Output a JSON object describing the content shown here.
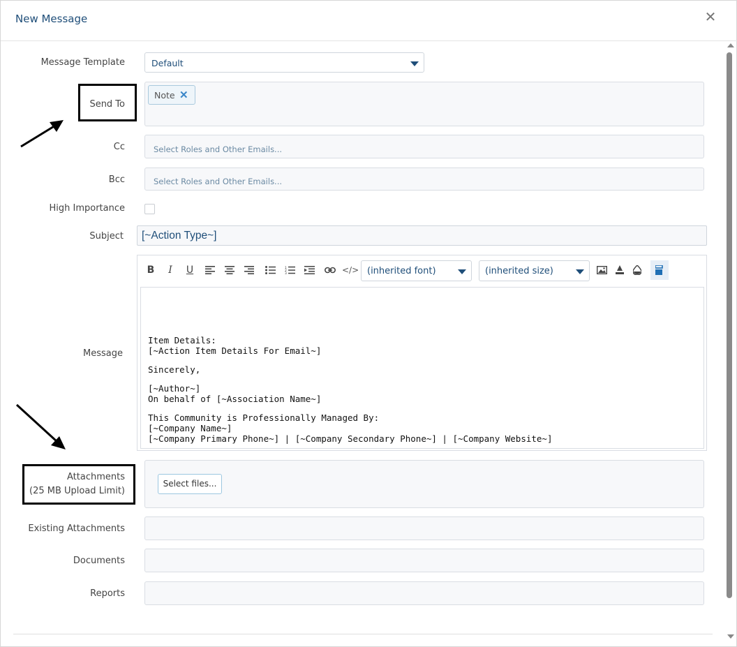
{
  "dialog": {
    "title": "New Message",
    "close_icon": "close-icon"
  },
  "form": {
    "message_template": {
      "label": "Message Template",
      "value": "Default"
    },
    "send_to": {
      "label": "Send To",
      "chips": [
        "Note"
      ]
    },
    "cc": {
      "label": "Cc",
      "placeholder": "Select Roles and Other Emails..."
    },
    "bcc": {
      "label": "Bcc",
      "placeholder": "Select Roles and Other Emails..."
    },
    "high_importance": {
      "label": "High Importance",
      "checked": false
    },
    "subject": {
      "label": "Subject",
      "value": "[~Action Type~]"
    },
    "message": {
      "label": "Message",
      "toolbar": {
        "bold": "B",
        "italic": "I",
        "underline": "U",
        "font": "(inherited font)",
        "size": "(inherited size)"
      },
      "body": {
        "l1": "Item Details:",
        "l2": "[~Action Item Details For Email~]",
        "l3": "Sincerely,",
        "l4": "[~Author~]",
        "l5": "On behalf of [~Association Name~]",
        "l6": "This Community is Professionally Managed By:",
        "l7": "[~Company Name~]",
        "l8": "[~Company Primary Phone~] | [~Company Secondary Phone~] | [~Company Website~]"
      }
    },
    "attachments": {
      "label": "Attachments",
      "sublabel": "(25 MB Upload Limit)",
      "button": "Select files..."
    },
    "existing_attachments": {
      "label": "Existing Attachments"
    },
    "documents": {
      "label": "Documents"
    },
    "reports": {
      "label": "Reports"
    }
  },
  "colors": {
    "accent": "#1f4e79",
    "link_blue": "#3a86c8",
    "field_bg": "#f7f8fa",
    "border": "#d9dde3"
  }
}
